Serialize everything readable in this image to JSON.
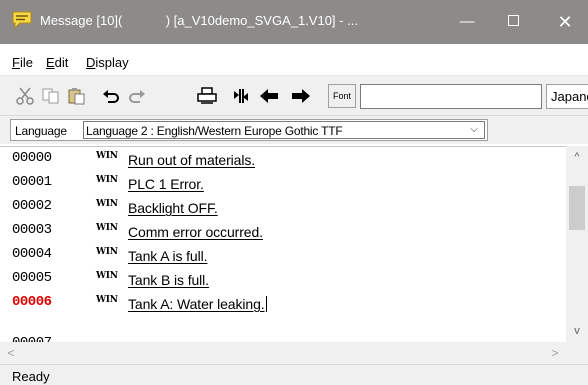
{
  "window": {
    "title": "Message [10](            ) [a_V10demo_SVGA_1.V10] - ...",
    "minimize_glyph": "—",
    "close_glyph": "✕",
    "icon": "message-icon"
  },
  "menu": {
    "items": [
      {
        "underline": "F",
        "rest": "ile"
      },
      {
        "underline": "E",
        "rest": "dit"
      },
      {
        "underline": "D",
        "rest": "isplay"
      }
    ]
  },
  "toolbar": {
    "font_label": "Font",
    "text_input_value": "",
    "language_value": "Japanese",
    "icons": [
      "cut-icon",
      "copy-icon",
      "paste-icon",
      "undo-icon",
      "redo-icon",
      "print-icon",
      "jump-icon",
      "previous-icon",
      "next-icon"
    ]
  },
  "language": {
    "label": "Language",
    "selected": "Language 2 : English/Western Europe Gothic TTF",
    "chevron": "⌵"
  },
  "messages": {
    "rows": [
      {
        "id": "00000",
        "tag": "WIN",
        "text": "Run out of materials."
      },
      {
        "id": "00001",
        "tag": "WIN",
        "text": "PLC 1 Error."
      },
      {
        "id": "00002",
        "tag": "WIN",
        "text": "Backlight OFF."
      },
      {
        "id": "00003",
        "tag": "WIN",
        "text": "Comm error occurred."
      },
      {
        "id": "00004",
        "tag": "WIN",
        "text": "Tank A is full."
      },
      {
        "id": "00005",
        "tag": "WIN",
        "text": "Tank B is full."
      },
      {
        "id": "00006",
        "tag": "WIN",
        "text": "Tank A: Water leaking."
      }
    ],
    "partial_row_id": "00007",
    "active_id": "00006",
    "active_color": "#e00000"
  },
  "scrollbars": {
    "up": "^",
    "down": "v",
    "left": "<",
    "right": ">"
  },
  "status": {
    "text": "Ready"
  },
  "colors": {
    "titlebar": "#8d8b8a",
    "toolbar": "#f0f0f0"
  }
}
